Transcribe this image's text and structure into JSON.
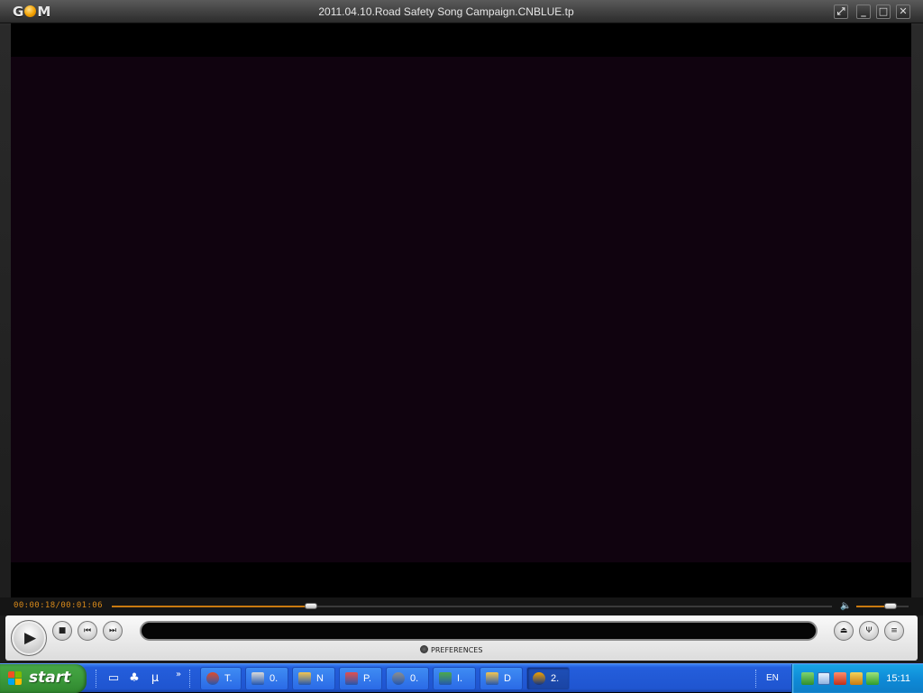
{
  "window": {
    "logo": "G",
    "logo_tail": "M",
    "title": "2011.04.10.Road Safety Song Campaign.CNBLUE.tp",
    "buttons": {
      "fullscreen": "⤢",
      "minimize": "_",
      "maximize": "□",
      "close": "✕"
    }
  },
  "player": {
    "time_readout": "00:00:18/00:01:06",
    "position_fraction": 0.276,
    "volume_fraction": 0.65,
    "preferences_label": "PREFERENCES",
    "colors": {
      "accent": "#c97a10",
      "video_bg": "#10030f",
      "time_text": "#d98a1a"
    },
    "icons": {
      "play": "▶",
      "stop": "■",
      "previous": "⏮",
      "next": "⏭",
      "eject": "⏏",
      "equalizer": "Ψ",
      "playlist": "≡",
      "volume": "🔈"
    }
  },
  "taskbar": {
    "start_label": "start",
    "tasks": [
      {
        "label": "T.",
        "icon": "chrome-icon",
        "color": "#e04a2a"
      },
      {
        "label": "0.",
        "icon": "paint-icon",
        "color": "#d8d8d8"
      },
      {
        "label": "N",
        "icon": "folder-icon",
        "color": "#f2c451"
      },
      {
        "label": "P.",
        "icon": "arrow-icon",
        "color": "#e24d4d"
      },
      {
        "label": "0.",
        "icon": "webcam-icon",
        "color": "#8c8c8c"
      },
      {
        "label": "I.",
        "icon": "network-icon",
        "color": "#4ba84b"
      },
      {
        "label": "D",
        "icon": "folder-icon",
        "color": "#f2c451"
      },
      {
        "label": "2.",
        "icon": "gom-icon",
        "color": "#f2a000"
      }
    ],
    "language": "EN",
    "clock": "15:11"
  }
}
